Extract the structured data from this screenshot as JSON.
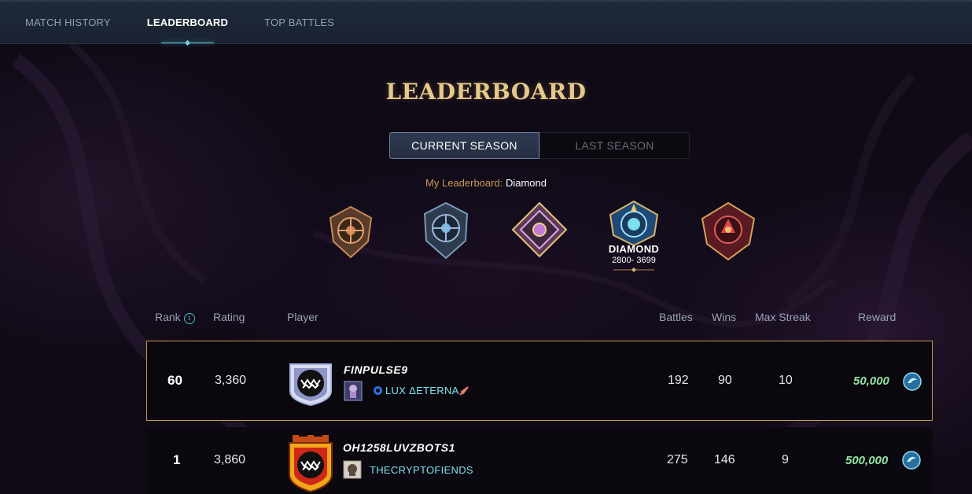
{
  "nav": {
    "tabs": [
      {
        "label": "MATCH HISTORY",
        "active": false
      },
      {
        "label": "LEADERBOARD",
        "active": true
      },
      {
        "label": "TOP BATTLES",
        "active": false
      }
    ]
  },
  "page": {
    "title": "LEADERBOARD"
  },
  "season": {
    "current_label": "CURRENT SEASON",
    "last_label": "LAST SEASON",
    "selected": "CURRENT SEASON"
  },
  "my_leaderboard": {
    "label": "My Leaderboard:",
    "value": "Diamond"
  },
  "leagues": {
    "icons": [
      "bronze-league-icon",
      "silver-league-icon",
      "gold-league-icon",
      "diamond-league-icon",
      "champion-league-icon"
    ],
    "selected": {
      "name": "DIAMOND",
      "range": "2800- 3699"
    }
  },
  "table": {
    "headers": {
      "rank": "Rank",
      "rating": "Rating",
      "player": "Player",
      "battles": "Battles",
      "wins": "Wins",
      "max_streak": "Max Streak",
      "reward": "Reward"
    },
    "rows": [
      {
        "rank": "60",
        "rating": "3,360",
        "player": "FINPULSE9",
        "guild": "LUX ΔETERNA",
        "battles": "192",
        "wins": "90",
        "max_streak": "10",
        "reward": "50,000",
        "highlighted": true
      },
      {
        "rank": "1",
        "rating": "3,860",
        "player": "OH1258LUVZBOTS1",
        "guild": "THECRYPTOFIENDS",
        "battles": "275",
        "wins": "146",
        "max_streak": "9",
        "reward": "500,000",
        "highlighted": false
      }
    ]
  },
  "colors": {
    "title_gold": "#e6c98a",
    "highlight_border": "#c79a55",
    "reward_green": "#93e3a3",
    "guild_cyan": "#7fe3ef",
    "active_tab_underline": "#4fb8c8"
  }
}
